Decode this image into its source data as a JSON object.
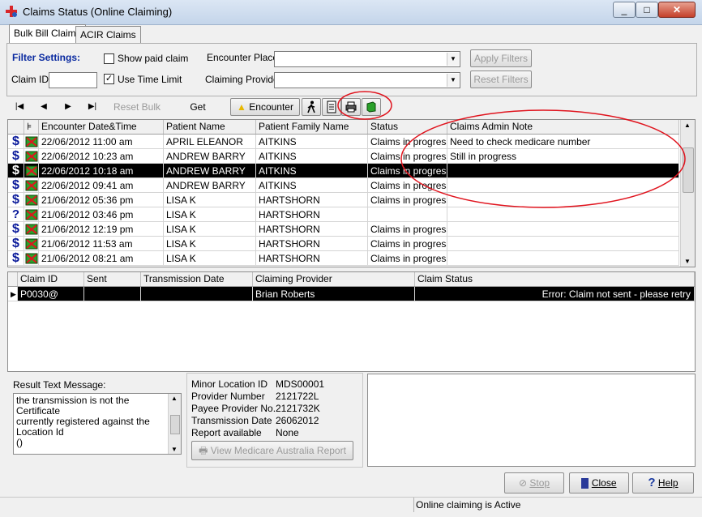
{
  "window": {
    "title": "Claims Status (Online Claiming)",
    "min_label": "_",
    "max_label": "□",
    "close_label": "✕"
  },
  "tabs": [
    {
      "label": "Bulk Bill Claims"
    },
    {
      "label": "ACIR Claims"
    }
  ],
  "filter": {
    "heading": "Filter Settings:",
    "show_paid_label": "Show paid claim",
    "show_paid_checked": "",
    "use_time_limit_label": "Use Time Limit",
    "use_time_limit_checked": "✓",
    "claim_id_label": "Claim ID",
    "claim_id_value": "",
    "encounter_place_label": "Encounter Place",
    "encounter_place_value": "",
    "claiming_provider_label": "Claiming Provider",
    "claiming_provider_value": "",
    "apply_label": "Apply Filters",
    "reset_label": "Reset Filters"
  },
  "toolbar": {
    "first": "|◀",
    "prev": "◀",
    "next": "▶",
    "last": "▶|",
    "reset_bulk_bill": "Reset Bulk Bill",
    "get_reports": "Get Reports",
    "encounter": "Encounter"
  },
  "grid": {
    "columns": [
      "Encounter Date&Time",
      "Patient Name",
      "Patient Family Name",
      "Status",
      "Claims Admin Note"
    ],
    "rows": [
      {
        "icon": "$",
        "date": "22/06/2012 11:00 am",
        "name": "APRIL ELEANOR",
        "family": "AITKINS",
        "status": "Claims in progress",
        "note": "Need to check medicare number"
      },
      {
        "icon": "$",
        "date": "22/06/2012 10:23 am",
        "name": "ANDREW BARRY",
        "family": "AITKINS",
        "status": "Claims in progress",
        "note": "Still in progress"
      },
      {
        "icon": "$",
        "date": "22/06/2012 10:18 am",
        "name": "ANDREW BARRY",
        "family": "AITKINS",
        "status": "Claims in progress",
        "note": "",
        "selected": true
      },
      {
        "icon": "$",
        "date": "22/06/2012 09:41 am",
        "name": "ANDREW BARRY",
        "family": "AITKINS",
        "status": "Claims in progress",
        "note": ""
      },
      {
        "icon": "$",
        "date": "21/06/2012 05:36 pm",
        "name": "LISA K",
        "family": "HARTSHORN",
        "status": "Claims in progress",
        "note": ""
      },
      {
        "icon": "?",
        "date": "21/06/2012 03:46 pm",
        "name": "LISA K",
        "family": "HARTSHORN",
        "status": "",
        "note": ""
      },
      {
        "icon": "$",
        "date": "21/06/2012 12:19 pm",
        "name": "LISA K",
        "family": "HARTSHORN",
        "status": "Claims in progress",
        "note": ""
      },
      {
        "icon": "$",
        "date": "21/06/2012 11:53 am",
        "name": "LISA K",
        "family": "HARTSHORN",
        "status": "Claims in progress",
        "note": ""
      },
      {
        "icon": "$",
        "date": "21/06/2012 08:21 am",
        "name": "LISA K",
        "family": "HARTSHORN",
        "status": "Claims in progress",
        "note": ""
      }
    ]
  },
  "claims_grid": {
    "columns": [
      "Claim ID",
      "Sent",
      "Transmission Date",
      "Claiming Provider",
      "Claim Status"
    ],
    "rows": [
      {
        "claim_id": "P0030@",
        "sent": "",
        "transmission_date": "",
        "provider": "Brian Roberts",
        "status": "Error: Claim not sent - please retry"
      }
    ]
  },
  "result": {
    "label": "Result Text Message:",
    "lines": [
      "the transmission is not the Certificate",
      "currently registered against the",
      "Location Id",
      "()"
    ]
  },
  "details": {
    "minor_location_label": "Minor Location ID",
    "minor_location_value": "MDS00001",
    "provider_number_label": "Provider Number",
    "provider_number_value": "2121722L",
    "payee_label": "Payee Provider No.",
    "payee_value": "2121732K",
    "transmission_label": "Transmission Date",
    "transmission_value": "26062012",
    "report_label": "Report available",
    "report_value": "None",
    "view_report_label": "View Medicare Australia Report"
  },
  "buttons": {
    "stop": "Stop",
    "close": "Close",
    "help": "Help"
  },
  "status": {
    "text": "Online claiming is Active"
  },
  "colors": {
    "annotation": "#e0141e",
    "dollar": "#0a1a9a",
    "selection": "#000000"
  }
}
